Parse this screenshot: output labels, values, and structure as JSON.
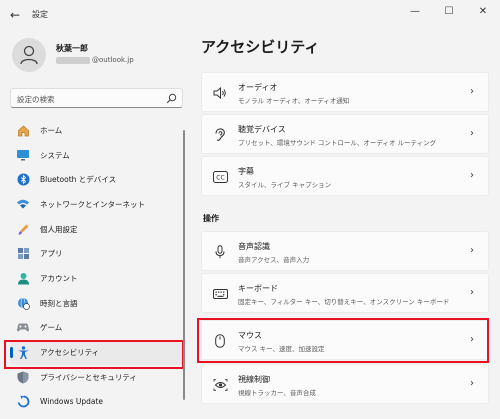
{
  "window": {
    "title": "設定",
    "back_glyph": "←",
    "minimize_glyph": "—",
    "maximize_glyph": "☐",
    "close_glyph": "✕"
  },
  "profile": {
    "name": "秋葉一郎",
    "email_domain": "@outlook.jp"
  },
  "search": {
    "placeholder": "設定の検索"
  },
  "sidebar": {
    "items": [
      {
        "label": "ホーム",
        "icon": "home-icon"
      },
      {
        "label": "システム",
        "icon": "monitor-icon"
      },
      {
        "label": "Bluetooth とデバイス",
        "icon": "bluetooth-icon"
      },
      {
        "label": "ネットワークとインターネット",
        "icon": "wifi-icon"
      },
      {
        "label": "個人用設定",
        "icon": "paintbrush-icon"
      },
      {
        "label": "アプリ",
        "icon": "apps-icon"
      },
      {
        "label": "アカウント",
        "icon": "person-icon"
      },
      {
        "label": "時刻と言語",
        "icon": "globe-clock-icon"
      },
      {
        "label": "ゲーム",
        "icon": "gamepad-icon"
      },
      {
        "label": "アクセシビリティ",
        "icon": "accessibility-icon",
        "selected": true
      },
      {
        "label": "プライバシーとセキュリティ",
        "icon": "shield-icon"
      },
      {
        "label": "Windows Update",
        "icon": "update-icon"
      }
    ]
  },
  "main": {
    "title": "アクセシビリティ",
    "section_operation": "操作",
    "cards": [
      {
        "title": "オーディオ",
        "subtitle": "モノラル オーディオ、オーディオ通知",
        "icon": "speaker-icon"
      },
      {
        "title": "聴覚デバイス",
        "subtitle": "プリセット、環境サウンド コントロール、オーディオ ルーティング",
        "icon": "ear-icon"
      },
      {
        "title": "字幕",
        "subtitle": "スタイル、ライブ キャプション",
        "icon": "captions-icon"
      },
      {
        "title": "音声認識",
        "subtitle": "音声アクセス、音声入力",
        "icon": "microphone-icon"
      },
      {
        "title": "キーボード",
        "subtitle": "固定キー、フィルター キー、切り替えキー、オンスクリーン キーボード",
        "icon": "keyboard-icon"
      },
      {
        "title": "マウス",
        "subtitle": "マウス キー、速度、加速設定",
        "icon": "mouse-icon"
      },
      {
        "title": "視線制御",
        "subtitle": "視線トラッカー、音声合成",
        "icon": "eye-control-icon"
      }
    ],
    "chevron": "›"
  },
  "colors": {
    "accent": "#005fb8",
    "highlight": "#e81224",
    "background": "#f3f3f3",
    "card": "#fbfbfb"
  }
}
